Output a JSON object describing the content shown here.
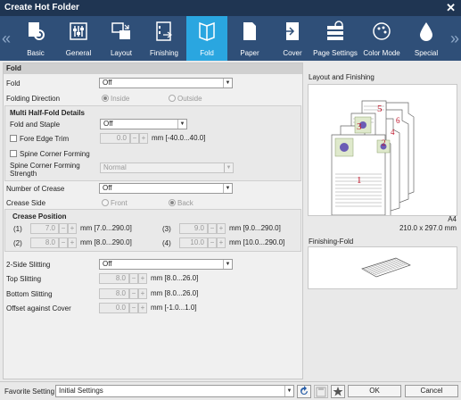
{
  "window": {
    "title": "Create Hot Folder"
  },
  "tabs": [
    {
      "label": "Basic",
      "icon": "basic-gear-icon"
    },
    {
      "label": "General",
      "icon": "general-sliders-icon"
    },
    {
      "label": "Layout",
      "icon": "layout-icon"
    },
    {
      "label": "Finishing",
      "icon": "finishing-icon"
    },
    {
      "label": "Fold",
      "icon": "fold-icon"
    },
    {
      "label": "Paper",
      "icon": "paper-icon"
    },
    {
      "label": "Cover",
      "icon": "cover-icon"
    },
    {
      "label": "Page Settings",
      "icon": "page-settings-icon"
    },
    {
      "label": "Color Mode",
      "icon": "palette-icon"
    },
    {
      "label": "Special",
      "icon": "drop-icon"
    }
  ],
  "fold": {
    "section_title": "Fold",
    "fold_label": "Fold",
    "fold_value": "Off",
    "direction_label": "Folding Direction",
    "direction_inside": "Inside",
    "direction_outside": "Outside",
    "multi_title": "Multi Half-Fold Details",
    "fold_staple_label": "Fold and Staple",
    "fold_staple_value": "Off",
    "fore_edge_label": "Fore Edge Trim",
    "fore_edge_value": "0.0",
    "fore_edge_unit": "mm [-40.0...40.0]",
    "spine_form_label": "Spine Corner Forming",
    "spine_strength_label": "Spine Corner Forming Strength",
    "spine_strength_value": "Normal",
    "crease_num_label": "Number of Crease",
    "crease_num_value": "Off",
    "crease_side_label": "Crease Side",
    "crease_front": "Front",
    "crease_back": "Back",
    "crease_pos_title": "Crease Position",
    "crease": [
      {
        "idx": "(1)",
        "value": "7.0",
        "unit": "mm [7.0...290.0]"
      },
      {
        "idx": "(2)",
        "value": "8.0",
        "unit": "mm [8.0...290.0]"
      },
      {
        "idx": "(3)",
        "value": "9.0",
        "unit": "mm [9.0...290.0]"
      },
      {
        "idx": "(4)",
        "value": "10.0",
        "unit": "mm [10.0...290.0]"
      }
    ],
    "slitting_label": "2-Side Slitting",
    "slitting_value": "Off",
    "top_slit_label": "Top Slitting",
    "top_slit_value": "8.0",
    "top_slit_unit": "mm [8.0...26.0]",
    "bottom_slit_label": "Bottom Slitting",
    "bottom_slit_value": "8.0",
    "bottom_slit_unit": "mm [8.0...26.0]",
    "offset_label": "Offset against Cover",
    "offset_value": "0.0",
    "offset_unit": "mm [-1.0...1.0]",
    "minus": "−",
    "plus": "+"
  },
  "preview": {
    "layout_title": "Layout and Finishing",
    "paper_size": "A4",
    "paper_dims": "210.0 x 297.0 mm",
    "page_numbers": [
      "5",
      "6",
      "3",
      "4",
      "2",
      "1"
    ],
    "fold_title": "Finishing-Fold"
  },
  "footer": {
    "favorite_label": "Favorite Setting",
    "favorite_value": "Initial Settings",
    "ok": "OK",
    "cancel": "Cancel"
  },
  "colors": {
    "titlebar": "#1f3552",
    "tabbar": "#2f4f78",
    "active_tab": "#2aa6e0",
    "page_number": "#c0152a"
  }
}
